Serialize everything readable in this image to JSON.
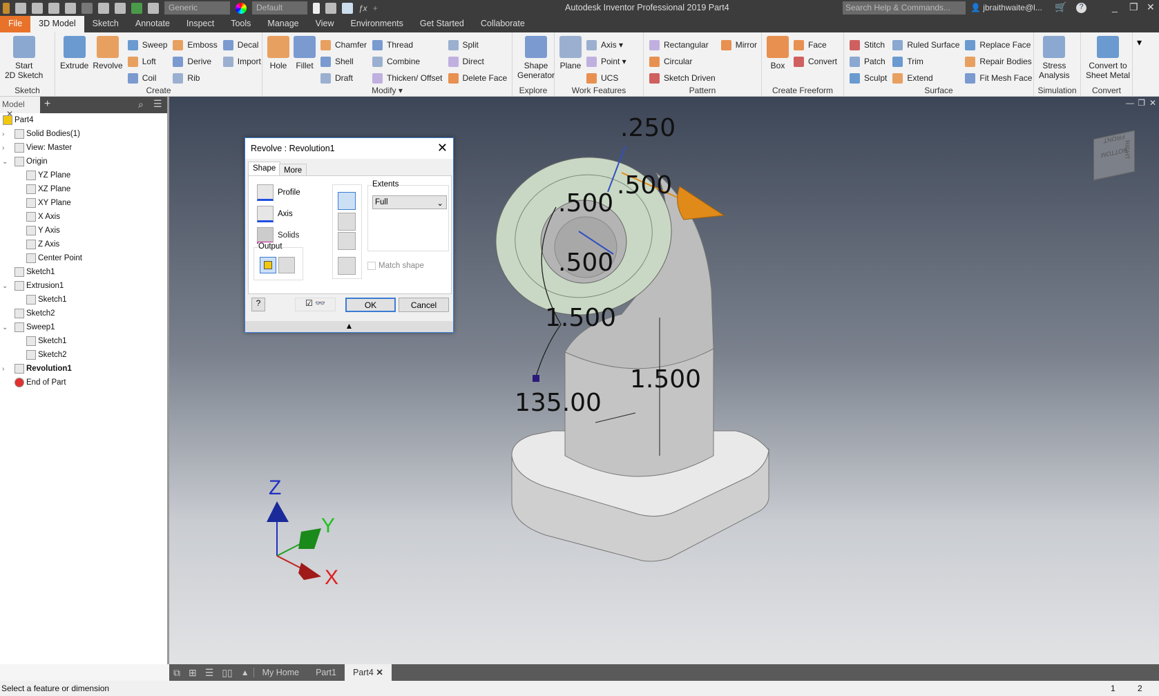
{
  "title_bar": {
    "app_title": "Autodesk Inventor Professional 2019   Part4",
    "material": "Generic",
    "appearance": "Default",
    "search_placeholder": "Search Help & Commands...",
    "user": "jbraithwaite@l...",
    "help": "?"
  },
  "tabs": [
    "File",
    "3D Model",
    "Sketch",
    "Annotate",
    "Inspect",
    "Tools",
    "Manage",
    "View",
    "Environments",
    "Get Started",
    "Collaborate"
  ],
  "active_tab": "3D Model",
  "ribbon": [
    {
      "label": "Sketch",
      "large": [
        "Start\n2D Sketch"
      ],
      "cols": []
    },
    {
      "label": "Create",
      "large": [
        "Extrude",
        "Revolve"
      ],
      "cols": [
        [
          "Sweep",
          "Loft",
          "Coil"
        ],
        [
          "Emboss",
          "Derive",
          "Rib"
        ],
        [
          "Decal",
          "Import"
        ]
      ]
    },
    {
      "label": "Modify ▾",
      "large": [
        "Hole",
        "Fillet"
      ],
      "cols": [
        [
          "Chamfer",
          "Shell",
          "Draft"
        ],
        [
          "Thread",
          "Combine",
          "Thicken/ Offset"
        ],
        [
          "Split",
          "Direct",
          "Delete Face"
        ]
      ]
    },
    {
      "label": "Explore",
      "large": [
        "Shape\nGenerator"
      ],
      "cols": []
    },
    {
      "label": "Work Features",
      "large": [
        "Plane"
      ],
      "cols": [
        [
          "Axis ▾",
          "Point ▾",
          "UCS"
        ]
      ]
    },
    {
      "label": "Pattern",
      "large": [],
      "cols": [
        [
          "Rectangular",
          "Circular",
          "Sketch Driven"
        ],
        [
          "Mirror"
        ]
      ]
    },
    {
      "label": "Create Freeform",
      "large": [
        "Box"
      ],
      "cols": [
        [
          "Face",
          "Convert"
        ]
      ]
    },
    {
      "label": "Surface",
      "large": [],
      "cols": [
        [
          "Stitch",
          "Patch",
          "Sculpt"
        ],
        [
          "Ruled Surface",
          "Trim",
          "Extend"
        ],
        [
          "Replace Face",
          "Repair Bodies",
          "Fit Mesh Face"
        ]
      ]
    },
    {
      "label": "Simulation",
      "large": [
        "Stress\nAnalysis"
      ],
      "cols": []
    },
    {
      "label": "Convert",
      "large": [
        "Convert to\nSheet Metal"
      ],
      "cols": []
    }
  ],
  "browser": {
    "tab": "Model",
    "items": [
      {
        "label": "Part4",
        "level": 0
      },
      {
        "label": "Solid Bodies(1)",
        "level": 1,
        "exp": ">"
      },
      {
        "label": "View: Master",
        "level": 1,
        "exp": ">"
      },
      {
        "label": "Origin",
        "level": 1,
        "exp": "v"
      },
      {
        "label": "YZ Plane",
        "level": 2
      },
      {
        "label": "XZ Plane",
        "level": 2
      },
      {
        "label": "XY Plane",
        "level": 2
      },
      {
        "label": "X Axis",
        "level": 2
      },
      {
        "label": "Y Axis",
        "level": 2
      },
      {
        "label": "Z Axis",
        "level": 2
      },
      {
        "label": "Center Point",
        "level": 2
      },
      {
        "label": "Sketch1",
        "level": 1
      },
      {
        "label": "Extrusion1",
        "level": 1,
        "exp": "v"
      },
      {
        "label": "Sketch1",
        "level": 2
      },
      {
        "label": "Sketch2",
        "level": 1
      },
      {
        "label": "Sweep1",
        "level": 1,
        "exp": "v"
      },
      {
        "label": "Sketch1",
        "level": 2
      },
      {
        "label": "Sketch2",
        "level": 2
      },
      {
        "label": "Revolution1",
        "level": 1,
        "exp": ">",
        "bold": true
      },
      {
        "label": "End of Part",
        "level": 1
      }
    ]
  },
  "dimensions": [
    ".250",
    ".500",
    ".500",
    ".500",
    "1.500",
    "1.500",
    "135.00"
  ],
  "triad": {
    "x": "X",
    "y": "Y",
    "z": "Z"
  },
  "viewcube": [
    "FRONT",
    "BOTTOM",
    "RIGHT"
  ],
  "dialog": {
    "title": "Revolve : Revolution1",
    "tabs": [
      "Shape",
      "More"
    ],
    "profile": "Profile",
    "axis": "Axis",
    "solids": "Solids",
    "output": "Output",
    "extents_label": "Extents",
    "extents_value": "Full",
    "match_shape": "Match shape",
    "ok": "OK",
    "cancel": "Cancel"
  },
  "doc_tabs": [
    "My Home",
    "Part1",
    "Part4"
  ],
  "status": {
    "text": "Select a feature or dimension",
    "n1": "1",
    "n2": "2"
  },
  "colors": {
    "accent": "#e8722a",
    "selection": "#3a7bd5",
    "part_face": "#c9d8c4"
  }
}
